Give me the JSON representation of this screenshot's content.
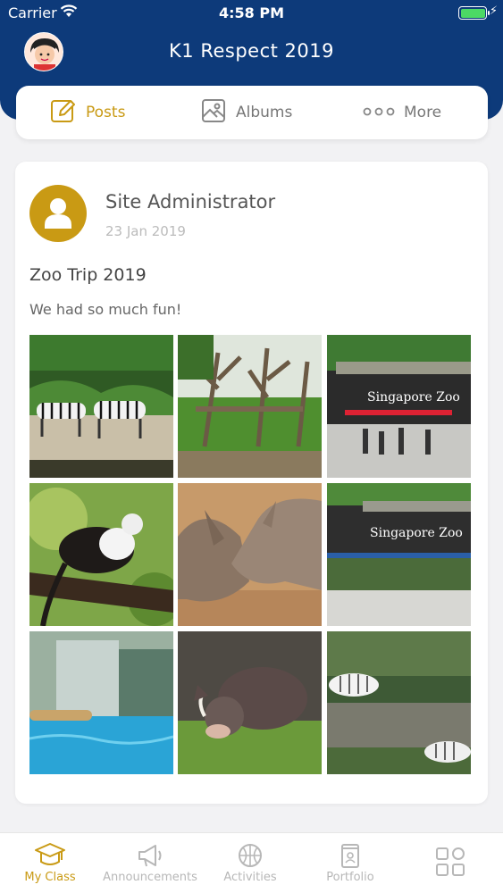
{
  "status_bar": {
    "carrier": "Carrier",
    "time": "4:58 PM"
  },
  "header": {
    "title": "K1 Respect 2019"
  },
  "tabs": [
    {
      "label": "Posts",
      "icon": "edit-icon",
      "active": true
    },
    {
      "label": "Albums",
      "icon": "image-icon",
      "active": false
    },
    {
      "label": "More",
      "icon": "more-dots-icon",
      "active": false
    }
  ],
  "post": {
    "author": "Site Administrator",
    "date": "23 Jan 2019",
    "title": "Zoo Trip 2019",
    "body": "We had so much fun!",
    "photos": [
      {
        "subject": "zebras",
        "sign": ""
      },
      {
        "subject": "bare tree enclosure",
        "sign": ""
      },
      {
        "subject": "zoo entrance",
        "sign": "Singapore Zoo"
      },
      {
        "subject": "monkey on branch",
        "sign": ""
      },
      {
        "subject": "rhinos",
        "sign": ""
      },
      {
        "subject": "zoo entrance",
        "sign": "Singapore Zoo"
      },
      {
        "subject": "pool",
        "sign": ""
      },
      {
        "subject": "warthog",
        "sign": ""
      },
      {
        "subject": "white tigers",
        "sign": ""
      }
    ]
  },
  "bottom_nav": [
    {
      "label": "My Class",
      "icon": "graduation-cap-icon",
      "active": true
    },
    {
      "label": "Announcements",
      "icon": "megaphone-icon",
      "active": false
    },
    {
      "label": "Activities",
      "icon": "basketball-icon",
      "active": false
    },
    {
      "label": "Portfolio",
      "icon": "portfolio-icon",
      "active": false
    },
    {
      "label": "",
      "icon": "grid-menu-icon",
      "active": false
    }
  ],
  "colors": {
    "header": "#0d3a7a",
    "accent": "#c99a14",
    "inactive": "#b7b7b7"
  }
}
